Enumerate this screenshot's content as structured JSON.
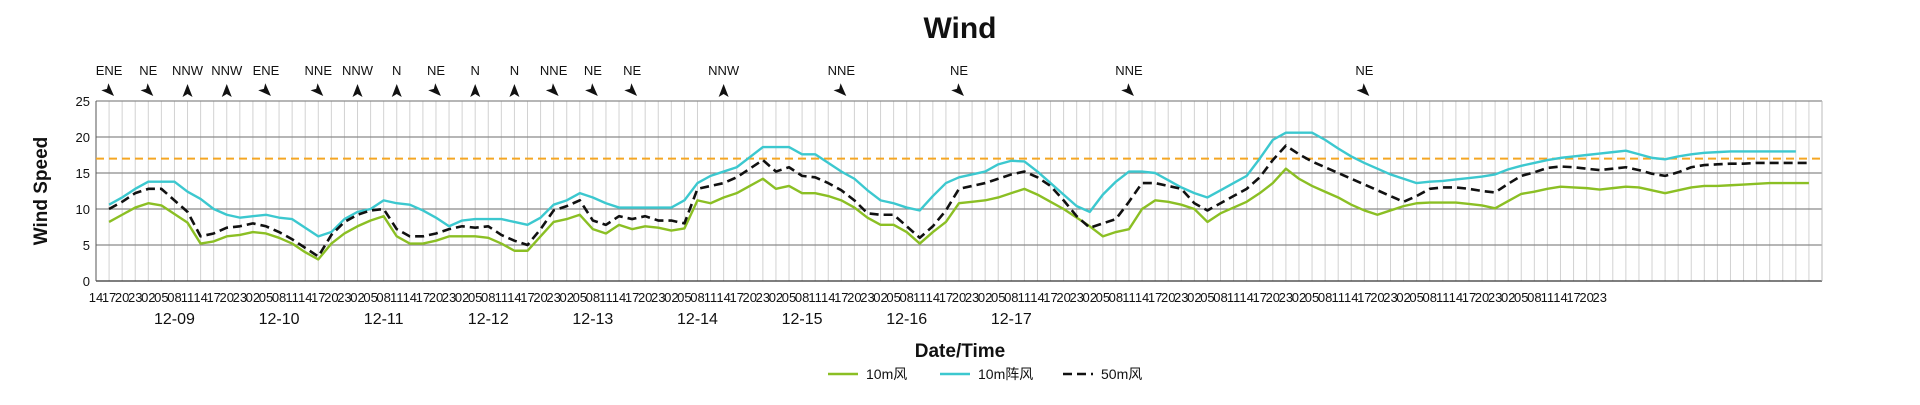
{
  "chart_data": {
    "type": "line",
    "title": "Wind",
    "xlabel": "Date/Time",
    "ylabel": "Wind Speed",
    "ylim": [
      0,
      25
    ],
    "yticks": [
      0,
      5,
      10,
      15,
      20,
      25
    ],
    "xlim": [
      0,
      132
    ],
    "hour_ticks": [
      "14",
      "17",
      "20",
      "23",
      "02",
      "05",
      "08",
      "11",
      "14",
      "17",
      "20",
      "23",
      "02",
      "05",
      "08",
      "11",
      "14",
      "17",
      "20",
      "23",
      "02",
      "05",
      "08",
      "11",
      "14",
      "17",
      "20",
      "23",
      "02",
      "05",
      "08",
      "11",
      "14",
      "17",
      "20",
      "23",
      "02",
      "05",
      "08",
      "11",
      "14",
      "17",
      "20",
      "23",
      "02",
      "05",
      "08",
      "11",
      "14",
      "17",
      "20",
      "23",
      "02",
      "05",
      "08",
      "11",
      "14",
      "17",
      "20",
      "23",
      "02",
      "05",
      "08",
      "11",
      "14",
      "17",
      "20",
      "23",
      "02",
      "05",
      "08",
      "11",
      "14",
      "17",
      "20",
      "23",
      "02",
      "05",
      "08",
      "11",
      "14",
      "17",
      "20",
      "23",
      "02",
      "05",
      "08",
      "11",
      "14",
      "17",
      "20",
      "23",
      "02",
      "05",
      "08",
      "11",
      "14",
      "17",
      "20",
      "23",
      "02",
      "05",
      "08",
      "11",
      "14",
      "17",
      "20",
      "23",
      "02",
      "05",
      "08",
      "11",
      "14",
      "17",
      "20",
      "23"
    ],
    "dates": [
      "12-09",
      "12-10",
      "12-11",
      "12-12",
      "12-13",
      "12-14",
      "12-15",
      "12-16",
      "12-17"
    ],
    "threshold": 17,
    "threshold_color": "#f5a623",
    "grid": true,
    "legend_position": "bottom",
    "x": [
      1,
      2,
      3,
      4,
      5,
      6,
      7,
      8,
      9,
      10,
      11,
      12,
      13,
      14,
      15,
      16,
      17,
      18,
      19,
      20,
      21,
      22,
      23,
      24,
      25,
      26,
      27,
      28,
      29,
      30,
      31,
      32,
      33,
      34,
      35,
      36,
      37,
      38,
      39,
      40,
      41,
      42,
      43,
      44,
      45,
      46,
      47,
      48,
      49,
      50,
      51,
      52,
      53,
      54,
      55,
      56,
      57,
      58,
      59,
      60,
      61,
      62,
      63,
      64,
      65,
      66,
      67,
      68,
      69,
      70,
      71,
      72,
      73,
      74,
      75,
      76,
      77,
      78,
      79,
      80,
      81,
      82,
      83,
      84,
      85,
      86,
      87,
      88,
      89,
      90,
      91,
      92,
      93,
      94,
      95,
      96,
      97,
      98,
      99,
      100,
      101,
      102,
      103,
      104,
      105,
      106,
      107,
      108,
      109,
      110,
      111,
      112,
      113,
      114,
      115,
      116,
      117,
      118,
      119,
      120,
      121,
      122,
      123,
      124,
      125,
      126,
      127,
      128,
      129,
      130,
      131
    ],
    "series": [
      {
        "name": "10m风",
        "color": "#8bbf24",
        "dash": false,
        "values": [
          8.2,
          9.2,
          10.2,
          10.8,
          10.5,
          9.3,
          8.1,
          5.2,
          5.5,
          6.2,
          6.4,
          6.8,
          6.6,
          6.0,
          5.2,
          4.0,
          3.0,
          5.2,
          6.6,
          7.6,
          8.4,
          9.0,
          6.2,
          5.2,
          5.2,
          5.6,
          6.2,
          6.2,
          6.2,
          6.0,
          5.2,
          4.2,
          4.2,
          6.2,
          8.2,
          8.6,
          9.2,
          7.2,
          6.6,
          7.8,
          7.2,
          7.6,
          7.4,
          7.0,
          7.3,
          11.2,
          10.8,
          11.6,
          12.2,
          13.2,
          14.2,
          12.8,
          13.2,
          12.2,
          12.2,
          11.8,
          11.2,
          10.2,
          8.8,
          7.8,
          7.8,
          6.8,
          5.2,
          6.8,
          8.2,
          10.8,
          11.0,
          11.2,
          11.6,
          12.2,
          12.8,
          12.0,
          11.0,
          10.0,
          8.8,
          7.6,
          6.2,
          6.8,
          7.2,
          10.0,
          11.2,
          11.0,
          10.6,
          10.0,
          8.2,
          9.4,
          10.2,
          11.0,
          12.2,
          13.6,
          15.6,
          14.2,
          13.2,
          12.4,
          11.6,
          10.6,
          9.8,
          9.2,
          9.8,
          10.4,
          10.8,
          10.9,
          10.9,
          10.9,
          10.7,
          10.5,
          10.1,
          11.1,
          12.1,
          12.4,
          12.8,
          13.1,
          13.0,
          12.9,
          12.7,
          12.9,
          13.1,
          13.0,
          12.6,
          12.2,
          12.6,
          13.0,
          13.2,
          13.2,
          13.3,
          13.4,
          13.5,
          13.6,
          13.6,
          13.6,
          13.6
        ]
      },
      {
        "name": "10m阵风",
        "color": "#3cc8cf",
        "dash": false,
        "values": [
          10.6,
          11.6,
          12.8,
          13.8,
          13.8,
          13.8,
          12.4,
          11.4,
          10.0,
          9.2,
          8.8,
          9.0,
          9.2,
          8.8,
          8.6,
          7.4,
          6.2,
          6.8,
          8.6,
          9.6,
          10.0,
          11.2,
          10.8,
          10.6,
          9.8,
          8.8,
          7.6,
          8.4,
          8.6,
          8.6,
          8.6,
          8.2,
          7.8,
          8.8,
          10.6,
          11.2,
          12.2,
          11.6,
          10.8,
          10.2,
          10.2,
          10.2,
          10.2,
          10.2,
          11.2,
          13.6,
          14.6,
          15.2,
          15.8,
          17.2,
          18.6,
          18.6,
          18.6,
          17.6,
          17.6,
          16.4,
          15.2,
          14.2,
          12.6,
          11.2,
          10.8,
          10.2,
          9.8,
          11.8,
          13.6,
          14.4,
          14.8,
          15.2,
          16.2,
          16.7,
          16.6,
          15.2,
          13.6,
          12.0,
          10.4,
          9.6,
          12.0,
          13.8,
          15.2,
          15.2,
          15.0,
          14.0,
          13.0,
          12.2,
          11.6,
          12.6,
          13.6,
          14.6,
          17.0,
          19.6,
          20.6,
          20.6,
          20.6,
          19.6,
          18.4,
          17.3,
          16.4,
          15.6,
          14.8,
          14.2,
          13.6,
          13.8,
          13.9,
          14.1,
          14.3,
          14.5,
          14.8,
          15.5,
          16.0,
          16.4,
          16.8,
          17.1,
          17.3,
          17.5,
          17.7,
          17.9,
          18.1,
          17.6,
          17.1,
          16.9,
          17.3,
          17.6,
          17.8,
          17.9,
          18.0,
          18.0,
          18.0,
          18.0,
          18.0,
          18.0
        ]
      },
      {
        "name": "50m风",
        "color": "#111111",
        "dash": true,
        "values": [
          10.0,
          11.0,
          12.2,
          12.8,
          12.8,
          11.2,
          9.6,
          6.2,
          6.6,
          7.4,
          7.6,
          8.0,
          7.6,
          6.8,
          5.8,
          4.6,
          3.4,
          6.4,
          8.2,
          9.2,
          9.8,
          10.0,
          7.2,
          6.2,
          6.2,
          6.6,
          7.2,
          7.6,
          7.4,
          7.6,
          6.4,
          5.6,
          5.0,
          7.2,
          9.8,
          10.4,
          11.2,
          8.4,
          7.8,
          9.0,
          8.6,
          9.0,
          8.4,
          8.4,
          8.0,
          12.8,
          13.2,
          13.6,
          14.4,
          15.6,
          16.8,
          15.2,
          15.8,
          14.6,
          14.4,
          13.6,
          12.6,
          11.2,
          9.4,
          9.2,
          9.2,
          7.6,
          6.0,
          7.6,
          9.8,
          12.8,
          13.2,
          13.6,
          14.2,
          14.8,
          15.2,
          14.4,
          13.2,
          11.2,
          9.0,
          7.4,
          8.0,
          8.6,
          11.0,
          13.6,
          13.6,
          13.2,
          12.8,
          10.8,
          9.8,
          10.8,
          11.8,
          12.8,
          14.4,
          16.8,
          18.8,
          17.6,
          16.6,
          15.8,
          15.0,
          14.2,
          13.4,
          12.6,
          11.8,
          11.0,
          11.8,
          12.8,
          13.0,
          13.0,
          12.8,
          12.5,
          12.3,
          13.5,
          14.6,
          15.1,
          15.7,
          15.9,
          15.8,
          15.6,
          15.4,
          15.6,
          15.8,
          15.4,
          14.9,
          14.6,
          15.1,
          15.8,
          16.1,
          16.2,
          16.3,
          16.3,
          16.4,
          16.4,
          16.4,
          16.4,
          16.4
        ]
      }
    ],
    "wind_directions": [
      {
        "x": 1,
        "label": "ENE",
        "angle": 135
      },
      {
        "x": 4,
        "label": "NE",
        "angle": 135
      },
      {
        "x": 7,
        "label": "NNW",
        "angle": 0
      },
      {
        "x": 10,
        "label": "NNW",
        "angle": 0
      },
      {
        "x": 13,
        "label": "ENE",
        "angle": 135
      },
      {
        "x": 17,
        "label": "NNE",
        "angle": 135
      },
      {
        "x": 20,
        "label": "NNW",
        "angle": 0
      },
      {
        "x": 23,
        "label": "N",
        "angle": 0
      },
      {
        "x": 26,
        "label": "NE",
        "angle": 135
      },
      {
        "x": 29,
        "label": "N",
        "angle": 0
      },
      {
        "x": 32,
        "label": "N",
        "angle": 0
      },
      {
        "x": 35,
        "label": "NNE",
        "angle": 135
      },
      {
        "x": 38,
        "label": "NE",
        "angle": 135
      },
      {
        "x": 41,
        "label": "NE",
        "angle": 135
      },
      {
        "x": 48,
        "label": "NNW",
        "angle": 0
      },
      {
        "x": 57,
        "label": "NNE",
        "angle": 135
      },
      {
        "x": 66,
        "label": "NE",
        "angle": 135
      },
      {
        "x": 79,
        "label": "NNE",
        "angle": 135
      },
      {
        "x": 97,
        "label": "NE",
        "angle": 135
      }
    ]
  }
}
